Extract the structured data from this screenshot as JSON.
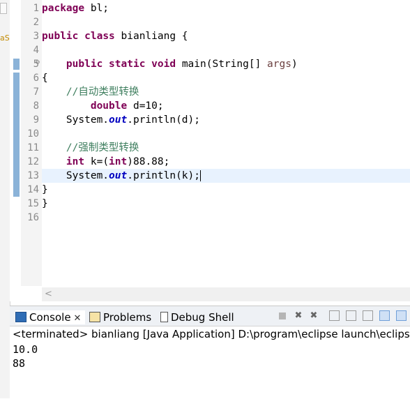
{
  "left_strip": {
    "fragment": "aS"
  },
  "editor": {
    "line_numbers": [
      "1",
      "2",
      "3",
      "4",
      "5",
      "6",
      "7",
      "8",
      "9",
      "10",
      "11",
      "12",
      "13",
      "14",
      "15",
      "16"
    ],
    "lines": [
      {
        "parts": [
          {
            "t": "package",
            "c": "kw"
          },
          {
            "t": " bl;",
            "c": ""
          }
        ]
      },
      {
        "parts": []
      },
      {
        "parts": [
          {
            "t": "public",
            "c": "kw"
          },
          {
            "t": " ",
            "c": ""
          },
          {
            "t": "class",
            "c": "kw"
          },
          {
            "t": " bianliang {",
            "c": ""
          }
        ]
      },
      {
        "parts": []
      },
      {
        "parts": [
          {
            "t": "    ",
            "c": ""
          },
          {
            "t": "public",
            "c": "kw"
          },
          {
            "t": " ",
            "c": ""
          },
          {
            "t": "static",
            "c": "kw"
          },
          {
            "t": " ",
            "c": ""
          },
          {
            "t": "void",
            "c": "kw"
          },
          {
            "t": " main(String[] ",
            "c": ""
          },
          {
            "t": "args",
            "c": "param"
          },
          {
            "t": ")",
            "c": ""
          }
        ]
      },
      {
        "parts": [
          {
            "t": "{",
            "c": ""
          }
        ]
      },
      {
        "parts": [
          {
            "t": "    ",
            "c": ""
          },
          {
            "t": "//自动类型转换",
            "c": "cm"
          }
        ]
      },
      {
        "parts": [
          {
            "t": "        ",
            "c": ""
          },
          {
            "t": "double",
            "c": "kw"
          },
          {
            "t": " d=10;",
            "c": ""
          }
        ]
      },
      {
        "parts": [
          {
            "t": "    System.",
            "c": ""
          },
          {
            "t": "out",
            "c": "fld"
          },
          {
            "t": ".println(d);",
            "c": ""
          }
        ]
      },
      {
        "parts": []
      },
      {
        "parts": [
          {
            "t": "    ",
            "c": ""
          },
          {
            "t": "//强制类型转换",
            "c": "cm"
          }
        ]
      },
      {
        "parts": [
          {
            "t": "    ",
            "c": ""
          },
          {
            "t": "int",
            "c": "kw"
          },
          {
            "t": " k=(",
            "c": ""
          },
          {
            "t": "int",
            "c": "kw"
          },
          {
            "t": ")88.88;",
            "c": ""
          }
        ]
      },
      {
        "parts": [
          {
            "t": "    System.",
            "c": ""
          },
          {
            "t": "out",
            "c": "fld"
          },
          {
            "t": ".println(k);",
            "c": ""
          }
        ]
      },
      {
        "parts": [
          {
            "t": "}",
            "c": ""
          }
        ]
      },
      {
        "parts": [
          {
            "t": "}",
            "c": ""
          }
        ]
      },
      {
        "parts": []
      }
    ],
    "scroll_left_glyph": "<"
  },
  "console": {
    "tabs": [
      {
        "label": "Console",
        "close": "✕"
      },
      {
        "label": "Problems"
      },
      {
        "label": "Debug Shell"
      }
    ],
    "status": "<terminated> bianliang [Java Application] D:\\program\\eclipse launch\\eclipse-j",
    "output": [
      "10.0",
      "88"
    ]
  }
}
